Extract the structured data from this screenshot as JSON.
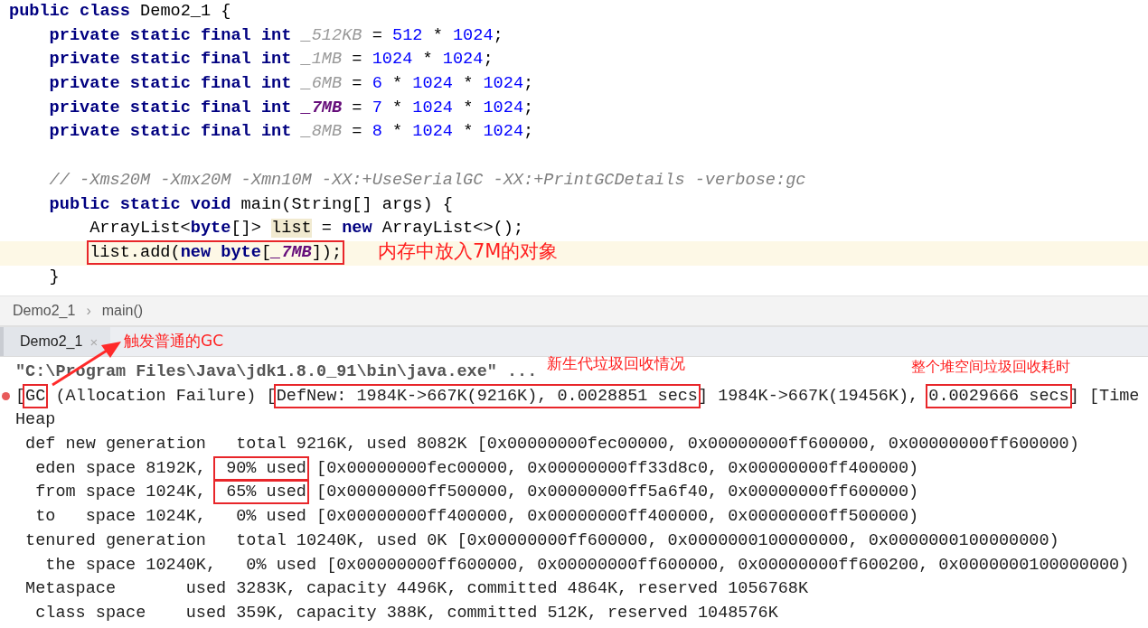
{
  "editor": {
    "lines": [
      {
        "current": false,
        "tokens": [
          {
            "kind": "keyword",
            "text": "public class "
          },
          {
            "kind": "plain",
            "text": "Demo2_1 {"
          }
        ],
        "children": [
          {
            "current": false,
            "tokens": [
              {
                "kind": "keyword",
                "text": "private static final int "
              },
              {
                "kind": "unused-constant",
                "text": "_512KB"
              },
              {
                "kind": "plain",
                "text": " = "
              },
              {
                "kind": "number",
                "text": "512"
              },
              {
                "kind": "plain",
                "text": " * "
              },
              {
                "kind": "number",
                "text": "1024"
              },
              {
                "kind": "plain",
                "text": ";"
              }
            ]
          },
          {
            "current": false,
            "tokens": [
              {
                "kind": "keyword",
                "text": "private static final int "
              },
              {
                "kind": "unused-constant",
                "text": "_1MB"
              },
              {
                "kind": "plain",
                "text": " = "
              },
              {
                "kind": "number",
                "text": "1024"
              },
              {
                "kind": "plain",
                "text": " * "
              },
              {
                "kind": "number",
                "text": "1024"
              },
              {
                "kind": "plain",
                "text": ";"
              }
            ]
          },
          {
            "current": false,
            "tokens": [
              {
                "kind": "keyword",
                "text": "private static final int "
              },
              {
                "kind": "unused-constant",
                "text": "_6MB"
              },
              {
                "kind": "plain",
                "text": " = "
              },
              {
                "kind": "number",
                "text": "6"
              },
              {
                "kind": "plain",
                "text": " * "
              },
              {
                "kind": "number",
                "text": "1024"
              },
              {
                "kind": "plain",
                "text": " * "
              },
              {
                "kind": "number",
                "text": "1024"
              },
              {
                "kind": "plain",
                "text": ";"
              }
            ]
          },
          {
            "current": false,
            "tokens": [
              {
                "kind": "keyword",
                "text": "private static final int "
              },
              {
                "kind": "constant",
                "text": "_7MB"
              },
              {
                "kind": "plain",
                "text": " = "
              },
              {
                "kind": "number",
                "text": "7"
              },
              {
                "kind": "plain",
                "text": " * "
              },
              {
                "kind": "number",
                "text": "1024"
              },
              {
                "kind": "plain",
                "text": " * "
              },
              {
                "kind": "number",
                "text": "1024"
              },
              {
                "kind": "plain",
                "text": ";"
              }
            ]
          },
          {
            "current": false,
            "tokens": [
              {
                "kind": "keyword",
                "text": "private static final int "
              },
              {
                "kind": "unused-constant",
                "text": "_8MB"
              },
              {
                "kind": "plain",
                "text": " = "
              },
              {
                "kind": "number",
                "text": "8"
              },
              {
                "kind": "plain",
                "text": " * "
              },
              {
                "kind": "number",
                "text": "1024"
              },
              {
                "kind": "plain",
                "text": " * "
              },
              {
                "kind": "number",
                "text": "1024"
              },
              {
                "kind": "plain",
                "text": ";"
              }
            ]
          },
          {
            "current": false
          },
          {
            "current": false,
            "tokens": [
              {
                "kind": "comment",
                "text": "// -Xms20M -Xmx20M -Xmn10M -XX:+UseSerialGC -XX:+PrintGCDetails -verbose:gc"
              }
            ]
          },
          {
            "current": false,
            "tokens": [
              {
                "kind": "keyword",
                "text": "public static void "
              },
              {
                "kind": "plain",
                "text": "main(String[] args) {"
              }
            ],
            "children": [
              {
                "current": false,
                "tokens": [
                  {
                    "kind": "plain",
                    "text": "ArrayList<"
                  },
                  {
                    "kind": "keyword",
                    "text": "byte"
                  },
                  {
                    "kind": "plain",
                    "text": "[]> "
                  },
                  {
                    "kind": "usage",
                    "text": "list"
                  },
                  {
                    "kind": "plain",
                    "text": " = "
                  },
                  {
                    "kind": "keyword",
                    "text": "new "
                  },
                  {
                    "kind": "plain",
                    "text": "ArrayList<>();"
                  }
                ]
              },
              {
                "current": true,
                "tokens": [
                  {
                    "kind": "marked",
                    "tokens": [
                      {
                        "kind": "plain",
                        "text": "list.add("
                      },
                      {
                        "kind": "keyword",
                        "text": "new byte"
                      },
                      {
                        "kind": "plain",
                        "text": "["
                      },
                      {
                        "kind": "constant",
                        "text": "_7MB"
                      },
                      {
                        "kind": "plain",
                        "text": "]);"
                      }
                    ]
                  }
                ]
              }
            ]
          },
          {
            "current": false,
            "tokens": [
              {
                "kind": "plain",
                "text": "}"
              }
            ]
          }
        ]
      }
    ]
  },
  "breadcrumb": {
    "items": [
      "Demo2_1",
      "main()"
    ],
    "separator": "›"
  },
  "run_tabs": [
    {
      "label": "Demo2_1",
      "selected": true,
      "close": "×"
    }
  ],
  "console": {
    "lines": [
      {
        "kind": "command",
        "text": "\"C:\\Program Files\\Java\\jdk1.8.0_91\\bin\\java.exe\" ..."
      },
      {
        "kind": "error",
        "tokens": [
          {
            "marked": false,
            "text": "["
          },
          {
            "marked": true,
            "text": "GC"
          },
          {
            "marked": false,
            "text": " (Allocation Failure) ["
          },
          {
            "marked": true,
            "text": "DefNew: 1984K->667K(9216K), 0.0028851 secs"
          },
          {
            "marked": false,
            "text": "] 1984K->667K(19456K), "
          },
          {
            "marked": true,
            "text": "0.0029666 secs"
          },
          {
            "marked": false,
            "text": "] [Time"
          }
        ]
      },
      {
        "kind": "output",
        "text": "Heap"
      },
      {
        "kind": "output",
        "text": " def new generation   total 9216K, used 8082K [0x00000000fec00000, 0x00000000ff600000, 0x00000000ff600000)"
      },
      {
        "kind": "output",
        "tokens": [
          {
            "marked": false,
            "text": "  eden space 8192K, "
          },
          {
            "marked": true,
            "text": " 90% used"
          },
          {
            "marked": false,
            "text": " [0x00000000fec00000, 0x00000000ff33d8c0, 0x00000000ff400000)"
          }
        ]
      },
      {
        "kind": "output",
        "tokens": [
          {
            "marked": false,
            "text": "  from space 1024K, "
          },
          {
            "marked": true,
            "text": " 65% used"
          },
          {
            "marked": false,
            "text": " [0x00000000ff500000, 0x00000000ff5a6f40, 0x00000000ff600000)"
          }
        ]
      },
      {
        "kind": "output",
        "text": "  to   space 1024K,   0% used [0x00000000ff400000, 0x00000000ff400000, 0x00000000ff500000)"
      },
      {
        "kind": "output",
        "text": " tenured generation   total 10240K, used 0K [0x00000000ff600000, 0x0000000100000000, 0x0000000100000000)"
      },
      {
        "kind": "output",
        "text": "   the space 10240K,   0% used [0x00000000ff600000, 0x00000000ff600000, 0x00000000ff600200, 0x0000000100000000)"
      },
      {
        "kind": "output",
        "text": " Metaspace       used 3283K, capacity 4496K, committed 4864K, reserved 1056768K"
      },
      {
        "kind": "output",
        "text": "  class space    used 359K, capacity 388K, committed 512K, reserved 1048576K"
      }
    ]
  },
  "annotations": [
    {
      "text": "内存中放入7M的对象"
    },
    {
      "text": "触发普通的GC"
    },
    {
      "text": "新生代垃圾回收情况"
    },
    {
      "text": "整个堆空间垃圾回收耗时"
    }
  ]
}
